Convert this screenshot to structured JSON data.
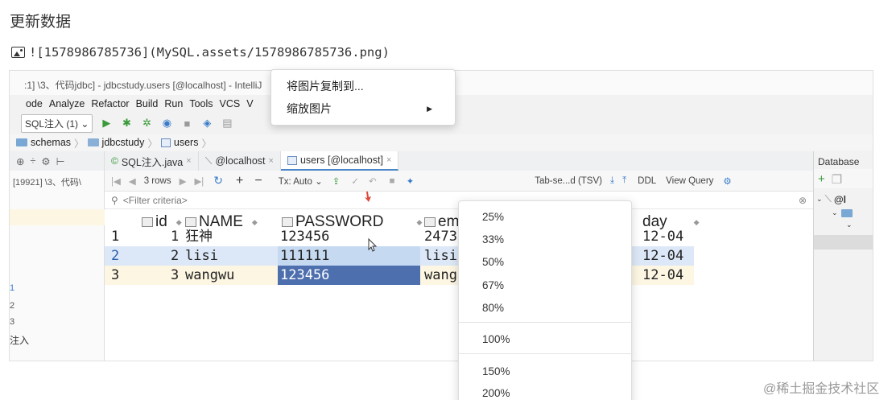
{
  "page": {
    "heading": "更新数据",
    "markdown_image": "![1578986785736](MySQL.assets/1578986785736.png)",
    "watermark": "@稀土掘金技术社区"
  },
  "ide": {
    "titlebar": ":1] \\3、代码jdbc] - jdbcstudy.users [@localhost] - IntelliJ",
    "menu": [
      "ode",
      "Analyze",
      "Refactor",
      "Build",
      "Run",
      "Tools",
      "VCS",
      "V"
    ],
    "toolbar": {
      "run_config": "SQL注入 (1)"
    },
    "breadcrumbs": [
      "schemas",
      "jdbcstudy",
      "users"
    ],
    "tabs": [
      {
        "label": "SQL注入.java",
        "active": false
      },
      {
        "label": "@localhost",
        "active": false
      },
      {
        "label": "users [@localhost]",
        "active": true
      }
    ],
    "right_panel": {
      "title": "Database",
      "item": "@l"
    },
    "left_panel": {
      "top_text": "[19921] \\3、代码\\",
      "bottom_text": "注入",
      "lines": [
        "1",
        "2",
        "3"
      ]
    },
    "grid_toolbar": {
      "rows": "3 rows",
      "tx": "Tx: Auto",
      "export_format": "Tab-se...d (TSV)",
      "ddl": "DDL",
      "view_query": "View Query"
    },
    "filter_placeholder": "<Filter criteria>",
    "grid": {
      "columns": [
        "id",
        "NAME",
        "PASSWORD",
        "em",
        "day"
      ],
      "rows": [
        {
          "num": "1",
          "id": "1",
          "name": "狂神",
          "password": "123456",
          "email": "2473",
          "birthday": "12-04"
        },
        {
          "num": "2",
          "id": "2",
          "name": "lisi",
          "password": "111111",
          "email": "lisi",
          "birthday": "12-04"
        },
        {
          "num": "3",
          "id": "3",
          "name": "wangwu",
          "password": "123456",
          "email": "wang",
          "birthday": "12-04"
        }
      ]
    }
  },
  "context_menu": {
    "items": [
      "将图片复制到...",
      "缩放图片"
    ]
  },
  "zoom_menu": {
    "items": [
      "25%",
      "33%",
      "50%",
      "67%",
      "80%",
      "100%",
      "150%",
      "200%"
    ]
  },
  "colors": {
    "row2_bg": "#dce8f7",
    "row3_bg": "#fdf6e3",
    "selected_cell": "#4d6fae",
    "selected_light": "#c5d9f1",
    "accent_arrow": "#e04a3a"
  }
}
